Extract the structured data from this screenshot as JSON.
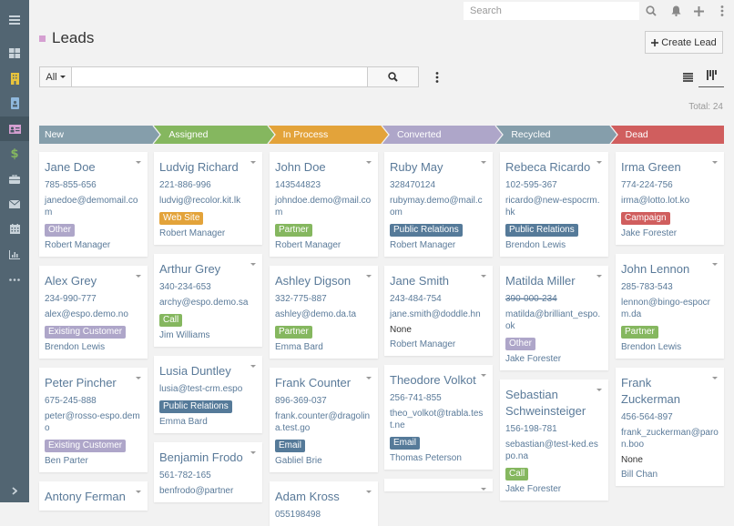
{
  "sidebar": {
    "items": [
      {
        "icon": "menu-icon",
        "label": "Menu"
      },
      {
        "icon": "dashboard-icon",
        "label": "Home"
      },
      {
        "icon": "building-icon",
        "label": "Accounts"
      },
      {
        "icon": "contact-badge-icon",
        "label": "Contacts"
      },
      {
        "icon": "lead-card-icon",
        "label": "Leads",
        "active": true
      },
      {
        "icon": "dollar-icon",
        "label": "Opportunities"
      },
      {
        "icon": "briefcase-icon",
        "label": "Cases"
      },
      {
        "icon": "envelope-icon",
        "label": "Emails"
      },
      {
        "icon": "calendar-icon",
        "label": "Calendar"
      },
      {
        "icon": "bar-chart-icon",
        "label": "Reports"
      },
      {
        "icon": "ellipsis-icon",
        "label": "More"
      }
    ],
    "collapse_icon": "chevron-right-icon"
  },
  "topbar": {
    "search_placeholder": "Search",
    "icons": [
      "search-icon",
      "bell-icon",
      "plus-icon",
      "kebab-menu-icon"
    ]
  },
  "header": {
    "title": "Leads",
    "create_button": "Create Lead",
    "accent_color": "#d59fd1"
  },
  "filter": {
    "scope_label": "All",
    "text_value": "",
    "total_label": "Total: 24"
  },
  "stages": [
    {
      "label": "New",
      "color": "#859eab"
    },
    {
      "label": "Assigned",
      "color": "#85b75f"
    },
    {
      "label": "In Process",
      "color": "#e3a33a"
    },
    {
      "label": "Converted",
      "color": "#aea6c9"
    },
    {
      "label": "Recycled",
      "color": "#859eab"
    },
    {
      "label": "Dead",
      "color": "#d05e5e"
    }
  ],
  "badge_colors": {
    "Other": "#aea6c9",
    "Existing Customer": "#aea6c9",
    "Web Site": "#e3a33a",
    "Call": "#85b75f",
    "Partner": "#85b75f",
    "Public Relations": "#557a99",
    "Email": "#557a99",
    "Campaign": "#d05e5e"
  },
  "columns": [
    {
      "stage": "New",
      "cards": [
        {
          "name": "Jane Doe",
          "phone": "785-855-656",
          "email": "janedoe@demomail.com",
          "source": "Other",
          "user": "Robert Manager"
        },
        {
          "name": "Alex Grey",
          "phone": "234-990-777",
          "email": "alex@espo.demo.no",
          "source": "Existing Customer",
          "user": "Brendon Lewis"
        },
        {
          "name": "Peter Pincher",
          "phone": "675-245-888",
          "email": "peter@rosso-espo.demo",
          "source": "Existing Customer",
          "user": "Ben Parter"
        },
        {
          "name": "Antony Ferman",
          "phone": "",
          "email": "",
          "source": "",
          "user": ""
        }
      ]
    },
    {
      "stage": "Assigned",
      "cards": [
        {
          "name": "Ludvig Richard",
          "phone": "221-886-996",
          "email": "ludvig@recolor.kit.lk",
          "source": "Web Site",
          "user": "Robert Manager"
        },
        {
          "name": "Arthur Grey",
          "phone": "340-234-653",
          "email": "archy@espo.demo.sa",
          "source": "Call",
          "user": "Jim Williams"
        },
        {
          "name": "Lusia Duntley",
          "phone": "",
          "email": "lusia@test-crm.espo",
          "source": "Public Relations",
          "user": "Emma Bard"
        },
        {
          "name": "Benjamin Frodo",
          "phone": "561-782-165",
          "email": "benfrodo@partner",
          "source": "",
          "user": ""
        }
      ]
    },
    {
      "stage": "In Process",
      "cards": [
        {
          "name": "John Doe",
          "phone": "143544823",
          "email": "johndoe.demo@mail.com",
          "source": "Partner",
          "user": "Robert Manager"
        },
        {
          "name": "Ashley Digson",
          "phone": "332-775-887",
          "email": "ashley@demo.da.ta",
          "source": "Partner",
          "user": "Emma Bard"
        },
        {
          "name": "Frank Counter",
          "phone": "896-369-037",
          "email": "frank.counter@dragolina.test.go",
          "source": "Email",
          "user": "Gabliel Brie"
        },
        {
          "name": "Adam Kross",
          "phone": "055198498",
          "email": "",
          "source": "",
          "user": ""
        }
      ]
    },
    {
      "stage": "Converted",
      "cards": [
        {
          "name": "Ruby May",
          "phone": "328470124",
          "email": "rubymay.demo@mail.com",
          "source": "Public Relations",
          "user": "Robert Manager"
        },
        {
          "name": "Jane Smith",
          "phone": "243-484-754",
          "email": "jane.smith@doddle.hn",
          "source": "None",
          "user": "Robert Manager"
        },
        {
          "name": "Theodore Volkot",
          "phone": "256-741-855",
          "email": "theo_volkot@trabla.test.ne",
          "source": "Email",
          "user": "Thomas Peterson"
        },
        {
          "name": "",
          "phone": "",
          "email": "",
          "source": "",
          "user": ""
        }
      ]
    },
    {
      "stage": "Recycled",
      "cards": [
        {
          "name": "Rebeca Ricardo",
          "phone": "102-595-367",
          "email": "ricardo@new-espocrm.hk",
          "source": "Public Relations",
          "user": "Brendon Lewis"
        },
        {
          "name": "Matilda Miller",
          "phone": "390-000-234",
          "phone_invalid": true,
          "email": "matilda@brilliant_espo.ok",
          "source": "Other",
          "user": "Jake Forester"
        },
        {
          "name": "Sebastian Schweinsteiger",
          "phone": "156-198-781",
          "email": "sebastian@test-ked.espo.na",
          "source": "Call",
          "user": "Jake Forester"
        }
      ]
    },
    {
      "stage": "Dead",
      "cards": [
        {
          "name": "Irma Green",
          "phone": "774-224-756",
          "email": "irma@lotto.lot.ko",
          "source": "Campaign",
          "user": "Jake Forester"
        },
        {
          "name": "John Lennon",
          "phone": "285-783-543",
          "email": "lennon@bingo-espocrm.da",
          "source": "Partner",
          "user": "Brendon Lewis"
        },
        {
          "name": "Frank Zuckerman",
          "phone": "456-564-897",
          "email": "frank_zuckerman@paron.boo",
          "source": "None",
          "user": "Bill Chan"
        }
      ]
    }
  ]
}
